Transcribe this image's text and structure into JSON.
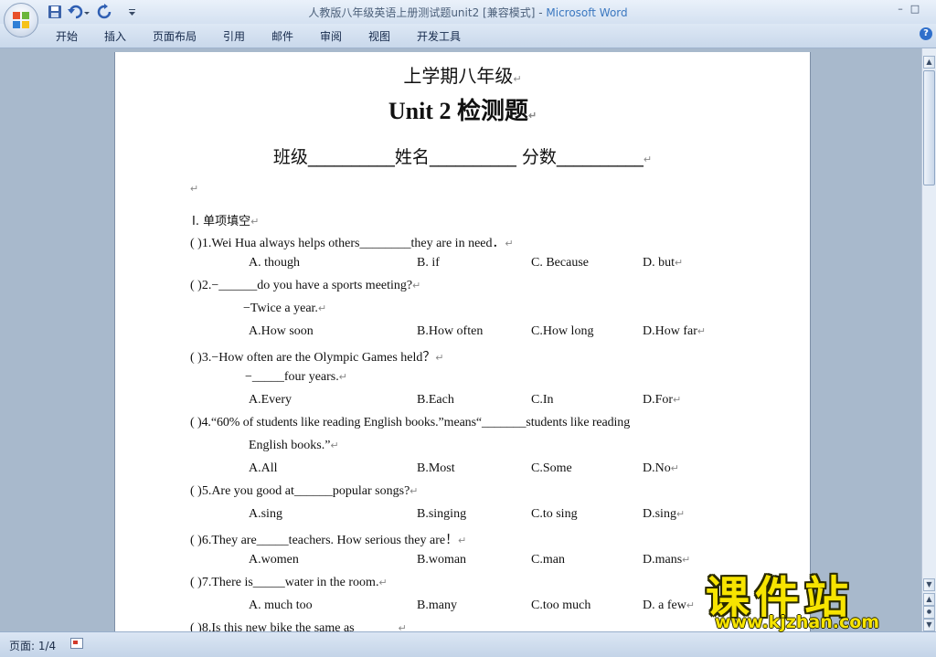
{
  "window": {
    "title": "人教版八年级英语上册测试题unit2 [兼容模式]",
    "title_sep": " - ",
    "app_name": "Microsoft Word",
    "accent": "#2f6fcb"
  },
  "icons": [
    "office-button-icon",
    "save-icon",
    "undo-icon",
    "redo-icon",
    "customize-qat-icon",
    "minimize-icon",
    "maximize-icon",
    "help-icon"
  ],
  "ribbon": {
    "tabs": [
      "开始",
      "插入",
      "页面布局",
      "引用",
      "邮件",
      "审阅",
      "视图",
      "开发工具"
    ]
  },
  "window_controls": {
    "minimize": "–",
    "maximize": "□",
    "help": "?"
  },
  "document": {
    "heading1": "上学期八年级",
    "heading2": "Unit 2 检测题",
    "info_line": "班级__________姓名__________  分数__________",
    "para_mark": "↵",
    "section_title": "Ⅰ. 单项填空",
    "q1": "(          )1.Wei Hua always helps others________they are in need．",
    "q1_opts": [
      "A. though",
      "B. if",
      "C. Because",
      "D. but"
    ],
    "q2": "(          )2.−______do you have a sports meeting?",
    "q2_b": "−Twice a year.",
    "q2_opts": [
      "A.How soon",
      "B.How often",
      "C.How long",
      "D.How far"
    ],
    "q3": "(          )3.−How often are the Olympic Games held？",
    "q3_b": "−_____four years.",
    "q3_opts": [
      "A.Every",
      "B.Each",
      "C.In",
      "D.For"
    ],
    "q4": "(          )4.“60%  of  students  like  reading  English  books.”means“_______students  like  reading",
    "q4_b": "English books.”",
    "q4_opts": [
      "A.All",
      "B.Most",
      "C.Some",
      "D.No"
    ],
    "q5": "(          )5.Are you good at______popular songs?",
    "q5_opts": [
      "A.sing",
      "B.singing",
      "C.to sing",
      "D.sing"
    ],
    "q6": "(          )6.They are_____teachers. How serious they are！",
    "q6_opts": [
      "A.women",
      "B.woman",
      "C.man",
      "D.mans"
    ],
    "q7": "(          )7.There is_____water in the room.",
    "q7_opts": [
      "A. much too",
      "B.many",
      "C.too much",
      "D. a few"
    ],
    "q8": "(          )8.Is this new bike the same as"
  },
  "status": {
    "page": "页面: 1/4"
  },
  "watermark": {
    "title": "课件站",
    "url": "www.kjzhan.com",
    "color": "#f7e400"
  }
}
